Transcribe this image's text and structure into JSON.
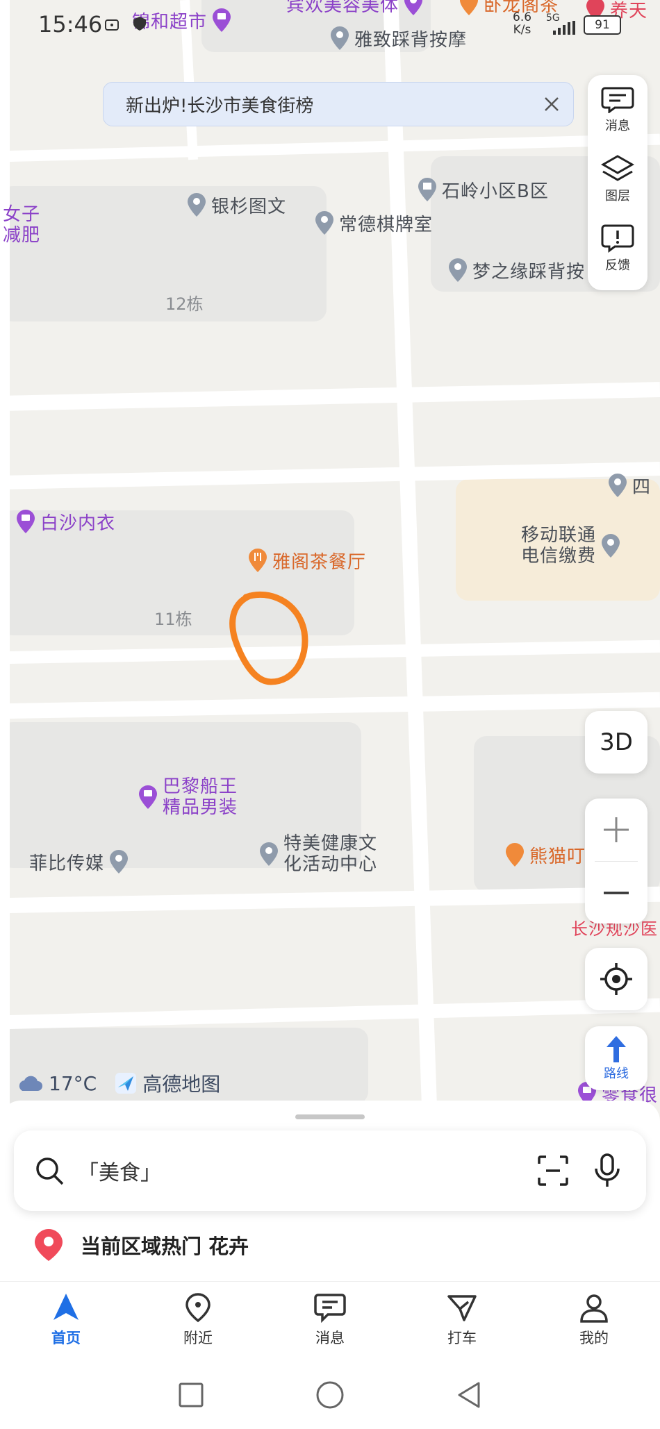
{
  "status_bar": {
    "time": "15:46",
    "net_speed": "6.6",
    "net_unit": "K/s",
    "network": "5G",
    "battery": "91"
  },
  "banner": {
    "text": "新出炉!长沙市美食街榜"
  },
  "side_panel": {
    "messages": "消息",
    "layers": "图层",
    "feedback": "反馈"
  },
  "map": {
    "pois": {
      "jinhe": "锦和超市",
      "binhuan": "宾欢美容美体",
      "wolong": "卧龙阁茶",
      "yangtian": "养天",
      "yazhi": "雅致踩背按摩",
      "yinshan": "银杉图文",
      "changde": "常德棋牌室",
      "shiling": "石岭小区B区",
      "mengzhiyuan": "梦之缘踩背按",
      "nvzi": "女子",
      "jianfei": "减肥",
      "baisha": "白沙内衣",
      "yage": "雅阁茶餐厅",
      "si": "四",
      "yidong_line1": "移动联通",
      "yidong_line2": "电信缴费",
      "bali_line1": "巴黎船王",
      "bali_line2": "精品男装",
      "feibi": "菲比传媒",
      "temei_line1": "特美健康文",
      "temei_line2": "化活动中心",
      "xiongmao": "熊猫叮",
      "changsha_hospital": "长沙规沙医",
      "lingshi": "零食很"
    },
    "buildings": {
      "b12": "12栋",
      "b11": "11栋"
    }
  },
  "controls": {
    "btn_3d": "3D",
    "route": "路线"
  },
  "weather": {
    "temperature": "17°C",
    "brand": "高德地图"
  },
  "search": {
    "placeholder": "「美食」"
  },
  "hot_area": {
    "text": "当前区域热门 花卉"
  },
  "tabs": [
    {
      "label": "首页"
    },
    {
      "label": "附近"
    },
    {
      "label": "消息"
    },
    {
      "label": "打车"
    },
    {
      "label": "我的"
    }
  ],
  "colors": {
    "accent": "#1f6fe5",
    "poi_purple": "#8b41c8",
    "poi_orange": "#d9682a",
    "annotation": "#f58220"
  }
}
